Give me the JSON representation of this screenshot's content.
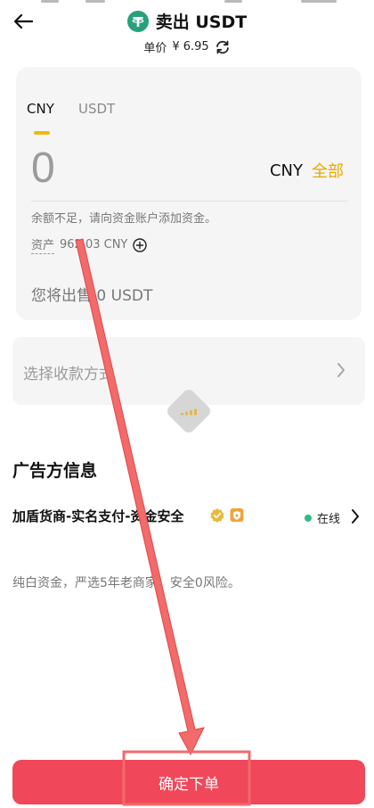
{
  "header": {
    "title": "卖出 USDT",
    "unit_price_label": "单价",
    "unit_price_value": "¥ 6.95"
  },
  "order_card": {
    "tabs": [
      {
        "label": "CNY",
        "active": true
      },
      {
        "label": "USDT",
        "active": false
      }
    ],
    "amount_value": "0",
    "currency": "CNY",
    "max_label": "全部",
    "hint": "余额不足，请向资金账户添加资金。",
    "asset_label": "资产",
    "asset_value": "962.03 CNY",
    "sell_summary": "您将出售 0 USDT"
  },
  "payment": {
    "placeholder": "选择收款方式"
  },
  "advertiser": {
    "section_title": "广告方信息",
    "name": "加盾货商-实名支付-资金安全",
    "status": "在线",
    "description": "纯白资金，严选5年老商家，安全0风险。"
  },
  "footer": {
    "confirm_label": "确定下单"
  },
  "colors": {
    "accent": "#f0b90b",
    "confirm": "#f0475a",
    "online": "#2ebd85",
    "usdt_logo": "#26a17b",
    "annotation": "#f26a6a"
  }
}
